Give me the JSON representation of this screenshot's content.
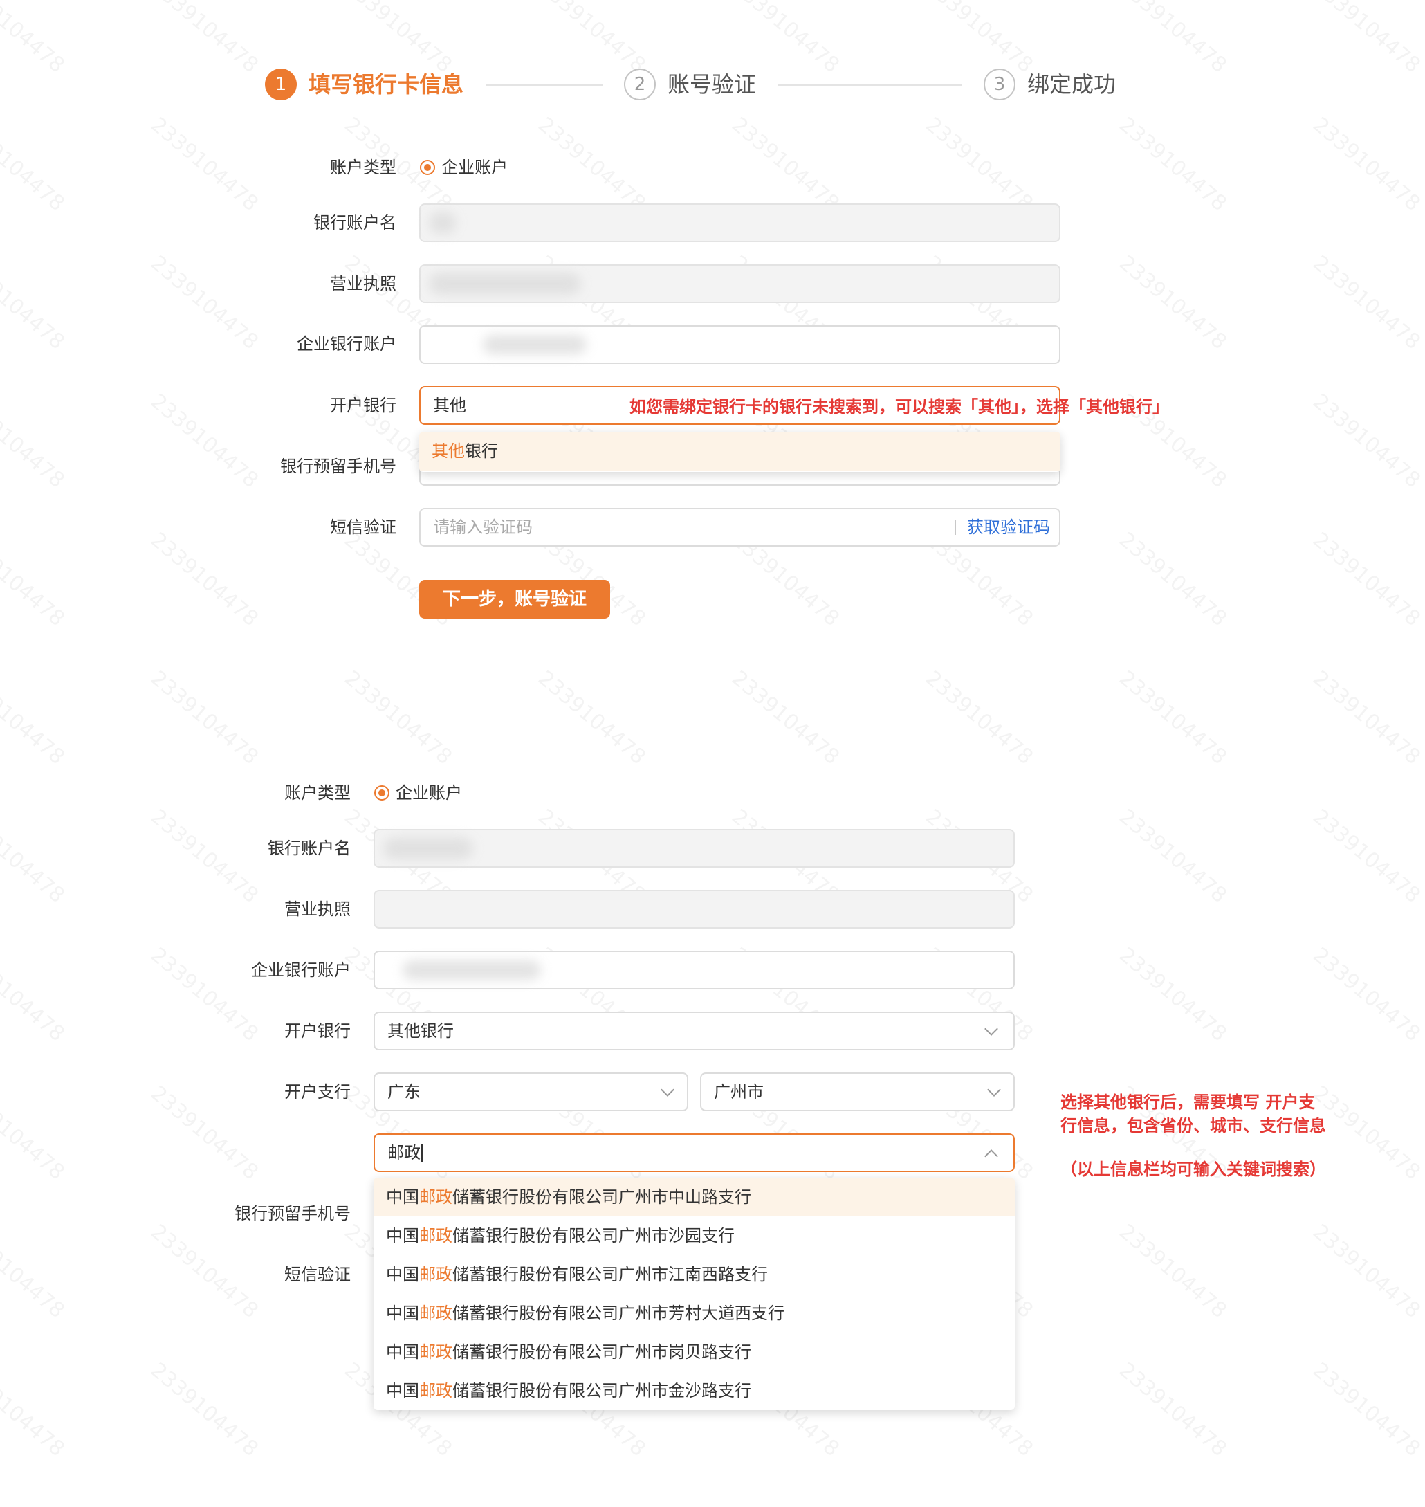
{
  "steps": [
    {
      "num": "1",
      "label": "填写银行卡信息"
    },
    {
      "num": "2",
      "label": "账号验证"
    },
    {
      "num": "3",
      "label": "绑定成功"
    }
  ],
  "colors": {
    "accent": "#ec7a2f",
    "link": "#2f6fd8",
    "annotation": "#e53935"
  },
  "watermark": "2339104478",
  "form1": {
    "account_type_label": "账户类型",
    "account_type_value": "企业账户",
    "bank_account_name_label": "银行账户名",
    "business_license_label": "营业执照",
    "corp_bank_account_label": "企业银行账户",
    "bank_label": "开户银行",
    "bank_value": "其他",
    "bank_dropdown": {
      "highlight": "其他",
      "rest": "银行"
    },
    "phone_label": "银行预留手机号",
    "sms_label": "短信验证",
    "sms_placeholder": "请输入验证码",
    "get_code": "获取验证码",
    "next_button": "下一步，账号验证",
    "annotation": "如您需绑定银行卡的银行未搜索到，可以搜索「其他」，选择「其他银行」"
  },
  "form2": {
    "account_type_label": "账户类型",
    "account_type_value": "企业账户",
    "bank_account_name_label": "银行账户名",
    "business_license_label": "营业执照",
    "corp_bank_account_label": "企业银行账户",
    "bank_label": "开户银行",
    "bank_value": "其他银行",
    "branch_label": "开户支行",
    "province_value": "广东",
    "city_value": "广州市",
    "branch_search_value": "邮政",
    "phone_label": "银行预留手机号",
    "sms_label": "短信验证",
    "branch_options": [
      {
        "pre": "中国",
        "hl": "邮政",
        "post": "储蓄银行股份有限公司广州市中山路支行"
      },
      {
        "pre": "中国",
        "hl": "邮政",
        "post": "储蓄银行股份有限公司广州市沙园支行"
      },
      {
        "pre": "中国",
        "hl": "邮政",
        "post": "储蓄银行股份有限公司广州市江南西路支行"
      },
      {
        "pre": "中国",
        "hl": "邮政",
        "post": "储蓄银行股份有限公司广州市芳村大道西支行"
      },
      {
        "pre": "中国",
        "hl": "邮政",
        "post": "储蓄银行股份有限公司广州市岗贝路支行"
      },
      {
        "pre": "中国",
        "hl": "邮政",
        "post": "储蓄银行股份有限公司广州市金沙路支行"
      }
    ],
    "annotation_line1": "选择其他银行后，需要填写 开户支",
    "annotation_line2": "行信息，包含省份、城市、支行信息",
    "annotation_line3": "（以上信息栏均可输入关键词搜索）"
  }
}
